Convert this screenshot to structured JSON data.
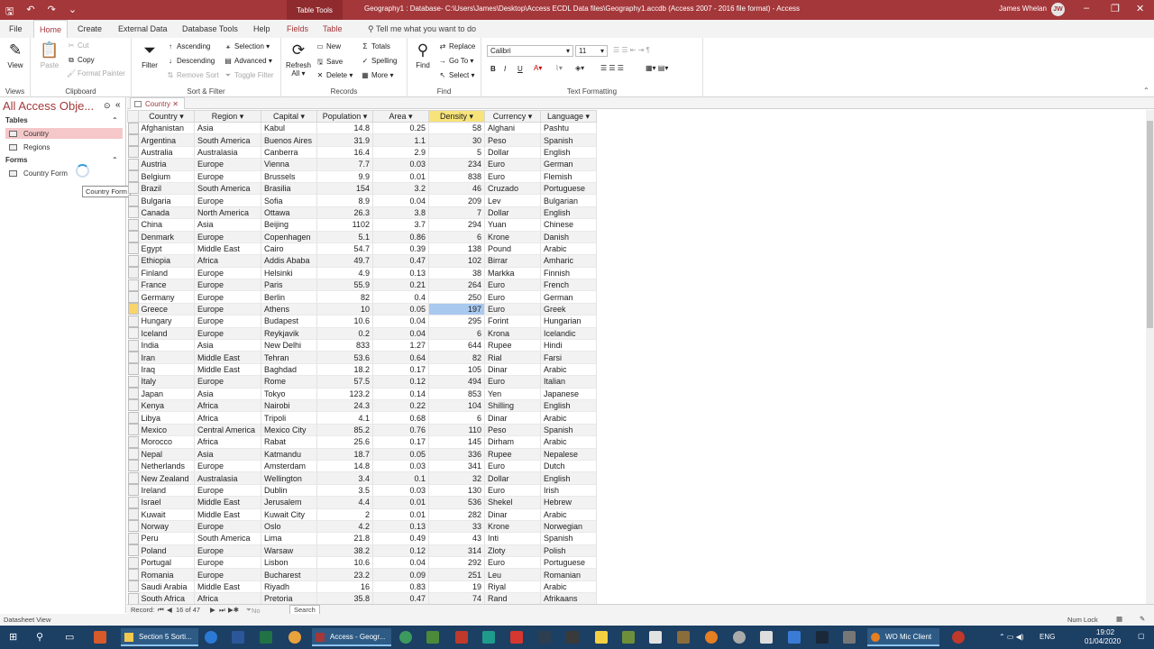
{
  "titlebar": {
    "context_tab": "Table Tools",
    "title": "Geography1 : Database- C:\\Users\\James\\Desktop\\Access ECDL Data files\\Geography1.accdb (Access 2007 - 2016 file format)  -  Access",
    "user": "James Whelan",
    "initials": "JW"
  },
  "tabs": [
    "File",
    "Home",
    "Create",
    "External Data",
    "Database Tools",
    "Help",
    "Fields",
    "Table"
  ],
  "tell_me": "Tell me what you want to do",
  "ribbon": {
    "views": {
      "view": "View",
      "label": "Views"
    },
    "clipboard": {
      "paste": "Paste",
      "cut": "Cut",
      "copy": "Copy",
      "format_painter": "Format Painter",
      "label": "Clipboard"
    },
    "sort_filter": {
      "filter": "Filter",
      "ascending": "Ascending",
      "descending": "Descending",
      "remove_sort": "Remove Sort",
      "selection": "Selection",
      "advanced": "Advanced",
      "toggle_filter": "Toggle Filter",
      "label": "Sort & Filter"
    },
    "records": {
      "refresh": "Refresh",
      "refresh2": "All",
      "new": "New",
      "save": "Save",
      "delete": "Delete",
      "totals": "Totals",
      "spelling": "Spelling",
      "more": "More",
      "label": "Records"
    },
    "find": {
      "find": "Find",
      "replace": "Replace",
      "goto": "Go To",
      "select": "Select",
      "label": "Find"
    },
    "text": {
      "font": "Calibri",
      "size": "11",
      "bold": "B",
      "italic": "I",
      "underline": "U",
      "label": "Text Formatting"
    }
  },
  "nav": {
    "title": "All Access Obje...",
    "tables_header": "Tables",
    "tables": [
      "Country",
      "Regions"
    ],
    "forms_header": "Forms",
    "forms": [
      "Country Form"
    ],
    "tooltip": "Country Form"
  },
  "doc_tab": "Country",
  "columns": [
    "Country",
    "Region",
    "Capital",
    "Population",
    "Area",
    "Density",
    "Currency",
    "Language"
  ],
  "rows": [
    [
      "Afghanistan",
      "Asia",
      "Kabul",
      "14.8",
      "0.25",
      "58",
      "Alghani",
      "Pashtu"
    ],
    [
      "Argentina",
      "South America",
      "Buenos Aires",
      "31.9",
      "1.1",
      "30",
      "Peso",
      "Spanish"
    ],
    [
      "Australia",
      "Australasia",
      "Canberra",
      "16.4",
      "2.9",
      "5",
      "Dollar",
      "English"
    ],
    [
      "Austria",
      "Europe",
      "Vienna",
      "7.7",
      "0.03",
      "234",
      "Euro",
      "German"
    ],
    [
      "Belgium",
      "Europe",
      "Brussels",
      "9.9",
      "0.01",
      "838",
      "Euro",
      "Flemish"
    ],
    [
      "Brazil",
      "South America",
      "Brasilia",
      "154",
      "3.2",
      "46",
      "Cruzado",
      "Portuguese"
    ],
    [
      "Bulgaria",
      "Europe",
      "Sofia",
      "8.9",
      "0.04",
      "209",
      "Lev",
      "Bulgarian"
    ],
    [
      "Canada",
      "North America",
      "Ottawa",
      "26.3",
      "3.8",
      "7",
      "Dollar",
      "English"
    ],
    [
      "China",
      "Asia",
      "Beijing",
      "1102",
      "3.7",
      "294",
      "Yuan",
      "Chinese"
    ],
    [
      "Denmark",
      "Europe",
      "Copenhagen",
      "5.1",
      "0.86",
      "6",
      "Krone",
      "Danish"
    ],
    [
      "Egypt",
      "Middle East",
      "Cairo",
      "54.7",
      "0.39",
      "138",
      "Pound",
      "Arabic"
    ],
    [
      "Ethiopia",
      "Africa",
      "Addis Ababa",
      "49.7",
      "0.47",
      "102",
      "Birrar",
      "Amharic"
    ],
    [
      "Finland",
      "Europe",
      "Helsinki",
      "4.9",
      "0.13",
      "38",
      "Markka",
      "Finnish"
    ],
    [
      "France",
      "Europe",
      "Paris",
      "55.9",
      "0.21",
      "264",
      "Euro",
      "French"
    ],
    [
      "Germany",
      "Europe",
      "Berlin",
      "82",
      "0.4",
      "250",
      "Euro",
      "German"
    ],
    [
      "Greece",
      "Europe",
      "Athens",
      "10",
      "0.05",
      "197",
      "Euro",
      "Greek"
    ],
    [
      "Hungary",
      "Europe",
      "Budapest",
      "10.6",
      "0.04",
      "295",
      "Forint",
      "Hungarian"
    ],
    [
      "Iceland",
      "Europe",
      "Reykjavik",
      "0.2",
      "0.04",
      "6",
      "Krona",
      "Icelandic"
    ],
    [
      "India",
      "Asia",
      "New Delhi",
      "833",
      "1.27",
      "644",
      "Rupee",
      "Hindi"
    ],
    [
      "Iran",
      "Middle East",
      "Tehran",
      "53.6",
      "0.64",
      "82",
      "Rial",
      "Farsi"
    ],
    [
      "Iraq",
      "Middle East",
      "Baghdad",
      "18.2",
      "0.17",
      "105",
      "Dinar",
      "Arabic"
    ],
    [
      "Italy",
      "Europe",
      "Rome",
      "57.5",
      "0.12",
      "494",
      "Euro",
      "Italian"
    ],
    [
      "Japan",
      "Asia",
      "Tokyo",
      "123.2",
      "0.14",
      "853",
      "Yen",
      "Japanese"
    ],
    [
      "Kenya",
      "Africa",
      "Nairobi",
      "24.3",
      "0.22",
      "104",
      "Shilling",
      "English"
    ],
    [
      "Libya",
      "Africa",
      "Tripoli",
      "4.1",
      "0.68",
      "6",
      "Dinar",
      "Arabic"
    ],
    [
      "Mexico",
      "Central America",
      "Mexico City",
      "85.2",
      "0.76",
      "110",
      "Peso",
      "Spanish"
    ],
    [
      "Morocco",
      "Africa",
      "Rabat",
      "25.6",
      "0.17",
      "145",
      "Dirham",
      "Arabic"
    ],
    [
      "Nepal",
      "Asia",
      "Katmandu",
      "18.7",
      "0.05",
      "336",
      "Rupee",
      "Nepalese"
    ],
    [
      "Netherlands",
      "Europe",
      "Amsterdam",
      "14.8",
      "0.03",
      "341",
      "Euro",
      "Dutch"
    ],
    [
      "New Zealand",
      "Australasia",
      "Wellington",
      "3.4",
      "0.1",
      "32",
      "Dollar",
      "English"
    ],
    [
      "Ireland",
      "Europe",
      "Dublin",
      "3.5",
      "0.03",
      "130",
      "Euro",
      "Irish"
    ],
    [
      "Israel",
      "Middle East",
      "Jerusalem",
      "4.4",
      "0.01",
      "536",
      "Shekel",
      "Hebrew"
    ],
    [
      "Kuwait",
      "Middle East",
      "Kuwait City",
      "2",
      "0.01",
      "282",
      "Dinar",
      "Arabic"
    ],
    [
      "Norway",
      "Europe",
      "Oslo",
      "4.2",
      "0.13",
      "33",
      "Krone",
      "Norwegian"
    ],
    [
      "Peru",
      "South America",
      "Lima",
      "21.8",
      "0.49",
      "43",
      "Inti",
      "Spanish"
    ],
    [
      "Poland",
      "Europe",
      "Warsaw",
      "38.2",
      "0.12",
      "314",
      "Zloty",
      "Polish"
    ],
    [
      "Portugal",
      "Europe",
      "Lisbon",
      "10.6",
      "0.04",
      "292",
      "Euro",
      "Portuguese"
    ],
    [
      "Romania",
      "Europe",
      "Bucharest",
      "23.2",
      "0.09",
      "251",
      "Leu",
      "Romanian"
    ],
    [
      "Saudi Arabia",
      "Middle East",
      "Riyadh",
      "16",
      "0.83",
      "19",
      "Riyal",
      "Arabic"
    ],
    [
      "South Africa",
      "Africa",
      "Pretoria",
      "35.8",
      "0.47",
      "74",
      "Rand",
      "Afrikaans"
    ]
  ],
  "current_row": 15,
  "current_col": 5,
  "record_nav": {
    "label": "Record:",
    "position": "16 of 47",
    "filter": "No Filter",
    "search": "Search"
  },
  "status": {
    "left": "Datasheet View",
    "right": "Num Lock"
  },
  "taskbar": {
    "app1": "Section 5 Sorti...",
    "app2": "Access - Geogr...",
    "app3": "WO Mic Client",
    "lang": "ENG",
    "time": "19:02",
    "date": "01/04/2020"
  },
  "colors": {
    "accent": "#a4373a",
    "taskbar": "#1c3f64",
    "selection": "#a9c9ef",
    "highlight": "#f7e37a"
  }
}
